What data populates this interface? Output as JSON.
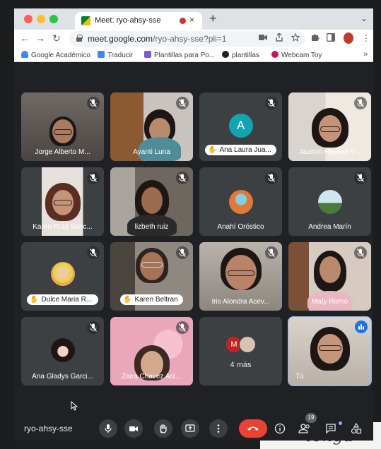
{
  "browser": {
    "tab_title": "Meet: ryo-ahsy-sse",
    "tab_close": "×",
    "new_tab": "+",
    "tab_menu": "⌄",
    "back": "←",
    "forward": "→",
    "reload": "↻",
    "url_host": "meet.google.com",
    "url_path": "/ryo-ahsy-sse?pli=1",
    "kebab": "⋮",
    "bookmarks": [
      "Google Académico",
      "Traducir",
      "Plantillas para Po...",
      "plantillas",
      "Webcam Toy"
    ],
    "bookmarks_more": "»"
  },
  "participants": [
    {
      "name": "Jorge Alberto M...",
      "muted": true,
      "kind": "video"
    },
    {
      "name": "Ayanti Luna",
      "muted": true,
      "kind": "video"
    },
    {
      "name": "Ana Laura Jua...",
      "muted": true,
      "kind": "avatar-letter",
      "initial": "A",
      "hand_raised": true
    },
    {
      "name": "Jazmín Haydee V...",
      "muted": true,
      "kind": "video"
    },
    {
      "name": "Karen Rubí Sanc...",
      "muted": true,
      "kind": "video"
    },
    {
      "name": "lizbeth ruiz",
      "muted": true,
      "kind": "video"
    },
    {
      "name": "Anahí Oróstico",
      "muted": true,
      "kind": "avatar-photo"
    },
    {
      "name": "Andrea Marín",
      "muted": true,
      "kind": "avatar-photo"
    },
    {
      "name": "Dulce Maria R...",
      "muted": true,
      "kind": "avatar-photo",
      "hand_raised": true
    },
    {
      "name": "Karen Beltran",
      "muted": true,
      "kind": "video",
      "hand_raised": true
    },
    {
      "name": "Iris Alondra Acev...",
      "muted": true,
      "kind": "video"
    },
    {
      "name": "Maty Romo",
      "muted": true,
      "kind": "video"
    },
    {
      "name": "Ana Gladys Garci...",
      "muted": true,
      "kind": "avatar-photo"
    },
    {
      "name": "Zaira Chavez Arz...",
      "muted": true,
      "kind": "video"
    },
    {
      "name": "4 más",
      "kind": "more",
      "initial": "M"
    },
    {
      "name": "Tú",
      "kind": "self",
      "speaking": true
    }
  ],
  "controls": {
    "meeting_code": "ryo-ahsy-sse",
    "people_count": "19"
  },
  "colors": {
    "meet_background": "#202124",
    "tile_background": "#3c4043",
    "end_call": "#ea4335",
    "accent": "#8ab4f8"
  },
  "handwriting": "tenga"
}
